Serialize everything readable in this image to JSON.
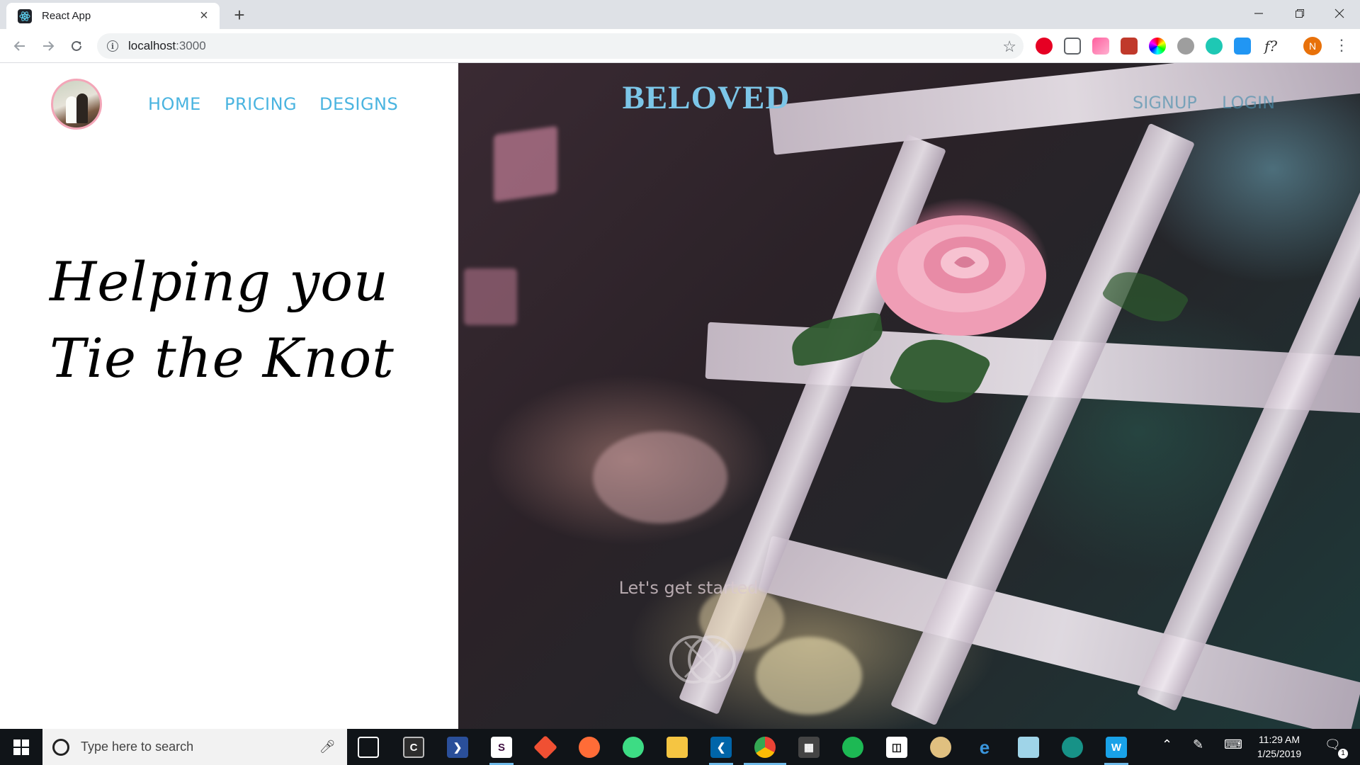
{
  "browser": {
    "tab_title": "React App",
    "url_host": "localhost",
    "url_port": ":3000",
    "window_controls": [
      "minimize",
      "maximize",
      "close"
    ]
  },
  "extensions": [
    "pinterest-icon",
    "screenshot-icon",
    "gradient-icon",
    "puzzle-icon",
    "color-wheel-icon",
    "pumpkin-icon",
    "teal-circle-icon",
    "tab-icon",
    "font-identifier-icon"
  ],
  "profile_initial": "N",
  "site": {
    "nav_links": [
      "HOME",
      "PRICING",
      "DESIGNS"
    ],
    "brand": "BELOVED",
    "auth_links": [
      "SIGNUP",
      "LOGIN"
    ],
    "hero_line1": "Helping you",
    "hero_line2": "Tie the Knot",
    "cta": "Let's get started",
    "accent_color": "#4ab4e0",
    "brand_color": "#7cc6e8"
  },
  "taskbar": {
    "search_placeholder": "Type here to search",
    "time": "11:29 AM",
    "date": "1/25/2019",
    "notification_count": "1",
    "apps": [
      "task-view-icon",
      "terminal-icon",
      "powershell-icon",
      "slack-icon",
      "git-icon",
      "postman-icon",
      "android-studio-icon",
      "file-explorer-icon",
      "vscode-icon",
      "chrome-icon",
      "calculator-icon",
      "spotify-icon",
      "kindle-icon",
      "paint-icon",
      "edge-icon",
      "notepad-icon",
      "gitkraken-icon",
      "webstorm-icon"
    ]
  }
}
